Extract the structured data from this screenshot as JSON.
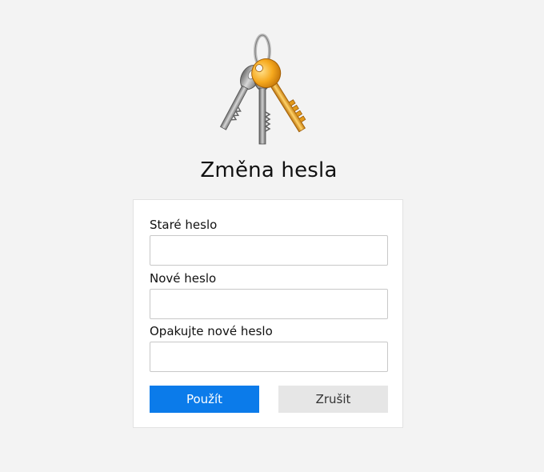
{
  "header": {
    "icon": "keys-icon",
    "title": "Změna hesla"
  },
  "form": {
    "fields": [
      {
        "label": "Staré heslo",
        "value": "",
        "placeholder": ""
      },
      {
        "label": "Nové heslo",
        "value": "",
        "placeholder": ""
      },
      {
        "label": "Opakujte nové heslo",
        "value": "",
        "placeholder": ""
      }
    ],
    "submit_label": "Použít",
    "cancel_label": "Zrušit"
  },
  "colors": {
    "page_background": "#f3f3f3",
    "card_background": "#ffffff",
    "primary_button": "#0b7bea",
    "secondary_button": "#e6e6e6",
    "key_gold": "#f0a020",
    "key_silver": "#9a9a9a"
  }
}
